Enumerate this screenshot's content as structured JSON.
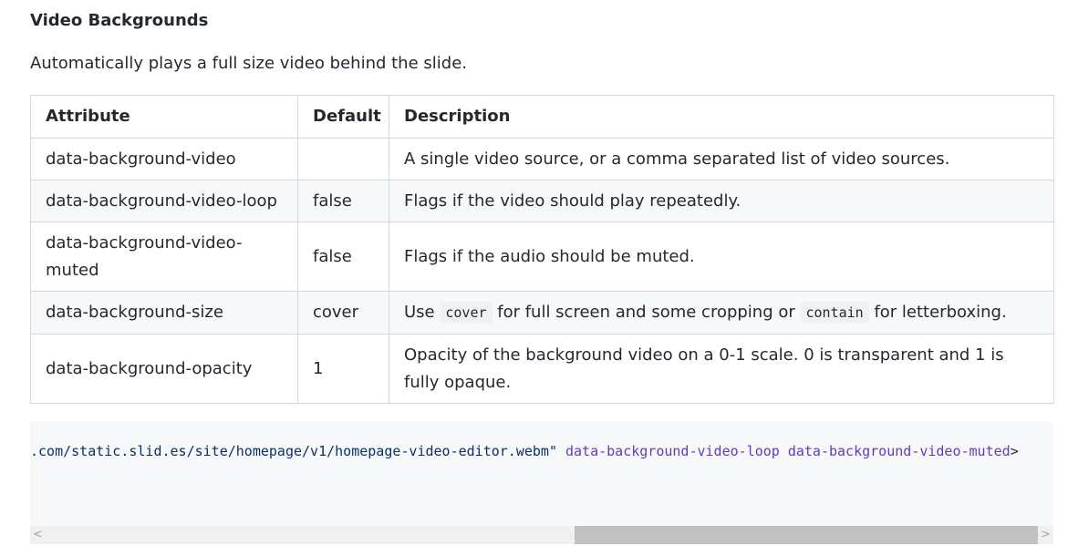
{
  "section": {
    "heading": "Video Backgrounds",
    "intro": "Automatically plays a full size video behind the slide."
  },
  "table": {
    "headers": [
      "Attribute",
      "Default",
      "Description"
    ],
    "rows": [
      {
        "attribute": "data-background-video",
        "default": "",
        "description": "A single video source, or a comma separated list of video sources."
      },
      {
        "attribute": "data-background-video-loop",
        "default": "false",
        "description": "Flags if the video should play repeatedly."
      },
      {
        "attribute": "data-background-video-muted",
        "default": "false",
        "description": "Flags if the audio should be muted."
      },
      {
        "attribute": "data-background-size",
        "default": "cover",
        "description_parts": [
          "Use ",
          "cover",
          " for full screen and some cropping or ",
          "contain",
          " for letterboxing."
        ]
      },
      {
        "attribute": "data-background-opacity",
        "default": "1",
        "description": "Opacity of the background video on a 0-1 scale. 0 is transparent and 1 is fully opaque."
      }
    ]
  },
  "code": {
    "url_fragment": ".com/static.slid.es/site/homepage/v1/homepage-video-editor.webm\"",
    "attr_loop": "data-background-video-loop",
    "attr_muted": "data-background-video-muted",
    "tag_close": ">"
  },
  "scrollbar": {
    "left_arrow_icon": "chevron-left-icon",
    "right_arrow_icon": "chevron-right-icon",
    "left_glyph": "<",
    "right_glyph": ">"
  }
}
